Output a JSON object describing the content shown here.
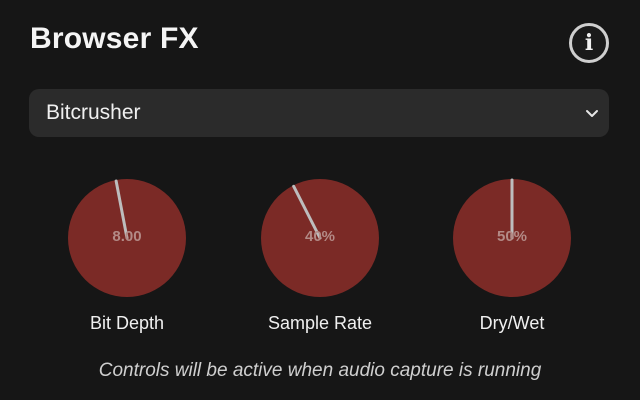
{
  "header": {
    "title": "Browser FX",
    "info_icon": "info-icon",
    "info_glyph": "i"
  },
  "effect_select": {
    "value": "Bitcrusher",
    "chevron_icon": "chevron-down-icon"
  },
  "knobs": [
    {
      "label": "Bit Depth",
      "value": "8.00",
      "level": 0.46
    },
    {
      "label": "Sample Rate",
      "value": "40%",
      "level": 0.4
    },
    {
      "label": "Dry/Wet",
      "value": "50%",
      "level": 0.5
    }
  ],
  "status": "Controls will be active when audio capture is running",
  "colors": {
    "background": "#161616",
    "select_bg": "#2b2b2b",
    "knob_fill": "#7b2a26",
    "knob_indicator": "#bdbdbd",
    "knob_value_text": "#b38a86"
  }
}
